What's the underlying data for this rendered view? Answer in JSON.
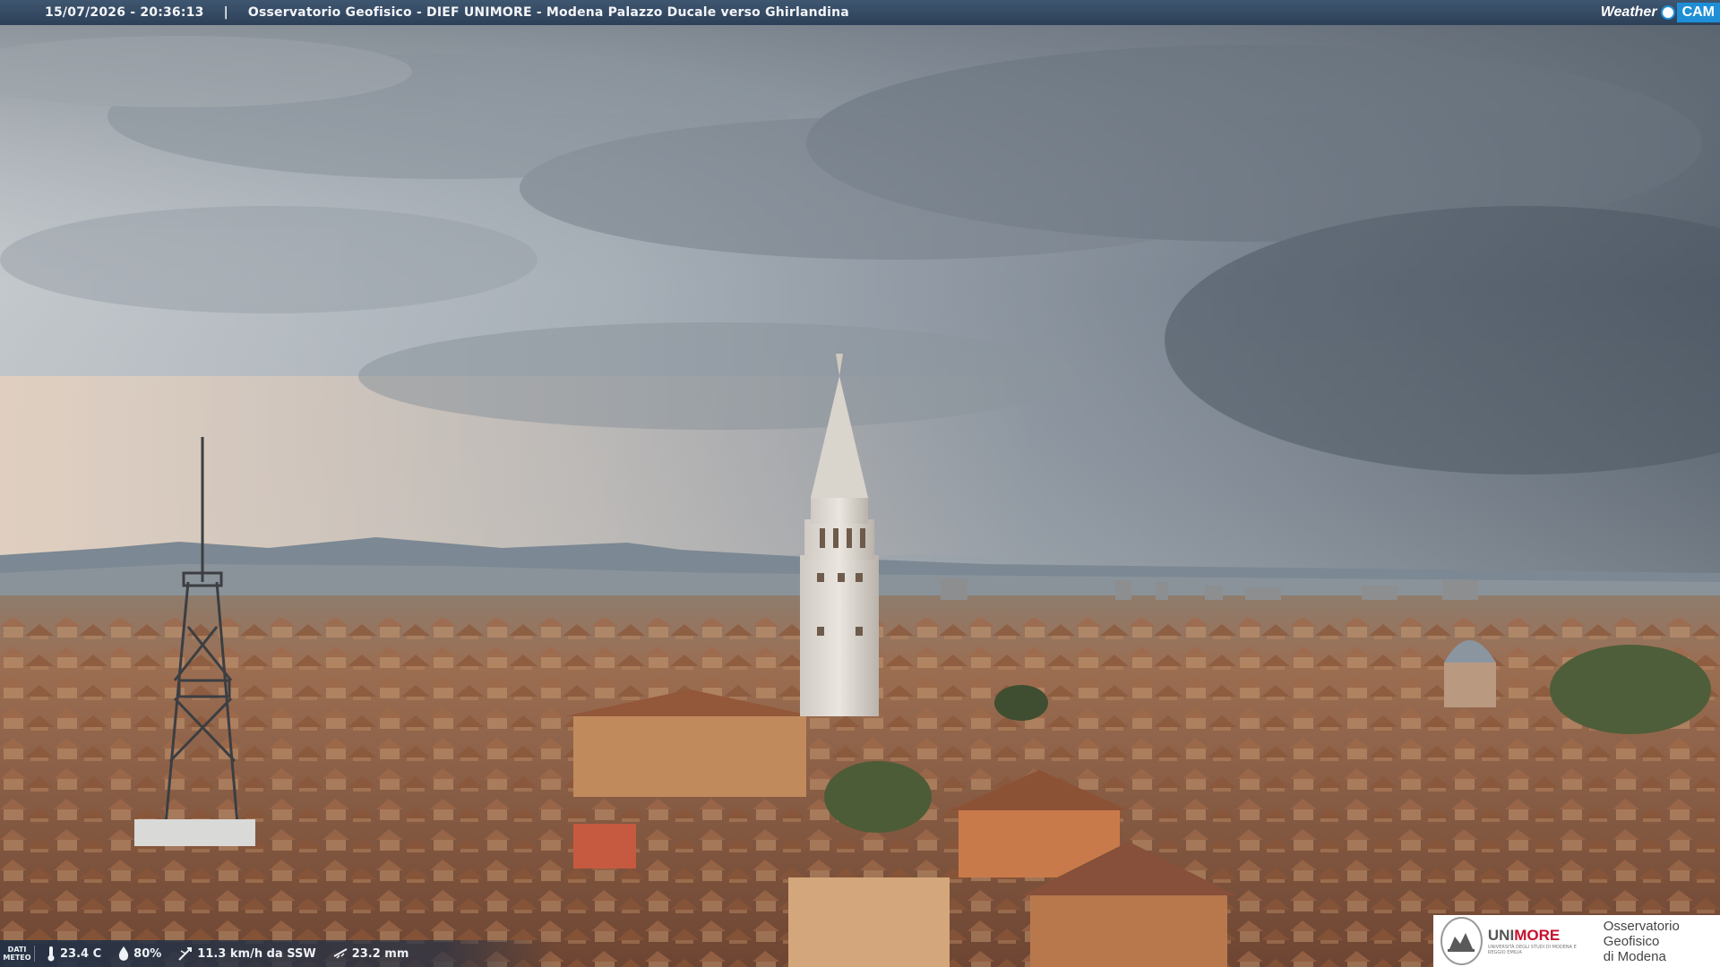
{
  "overlay": {
    "timestamp": "15/07/2026 - 20:36:13",
    "separator": "|",
    "location": "Osservatorio Geofisico - DIEF UNIMORE - Modena Palazzo Ducale verso Ghirlandina",
    "brand_weather": "Weather",
    "brand_cam": "CAM"
  },
  "weather": {
    "label": "DATI METEO",
    "temperature": "23.4 C",
    "humidity": "80%",
    "wind": "11.3 km/h da SSW",
    "rain": "23.2 mm"
  },
  "logo": {
    "uni_prefix": "UNI",
    "uni_suffix": "MORE",
    "uni_subtitle": "UNIVERSITÀ DEGLI STUDI DI MODENA E REGGIO EMILIA",
    "observatory_line1": "Osservatorio Geofisico",
    "observatory_line2": "di Modena"
  },
  "colors": {
    "bar": "#2d4058",
    "brand_blue": "#1e8fd6",
    "unimore_red": "#c8102e"
  }
}
